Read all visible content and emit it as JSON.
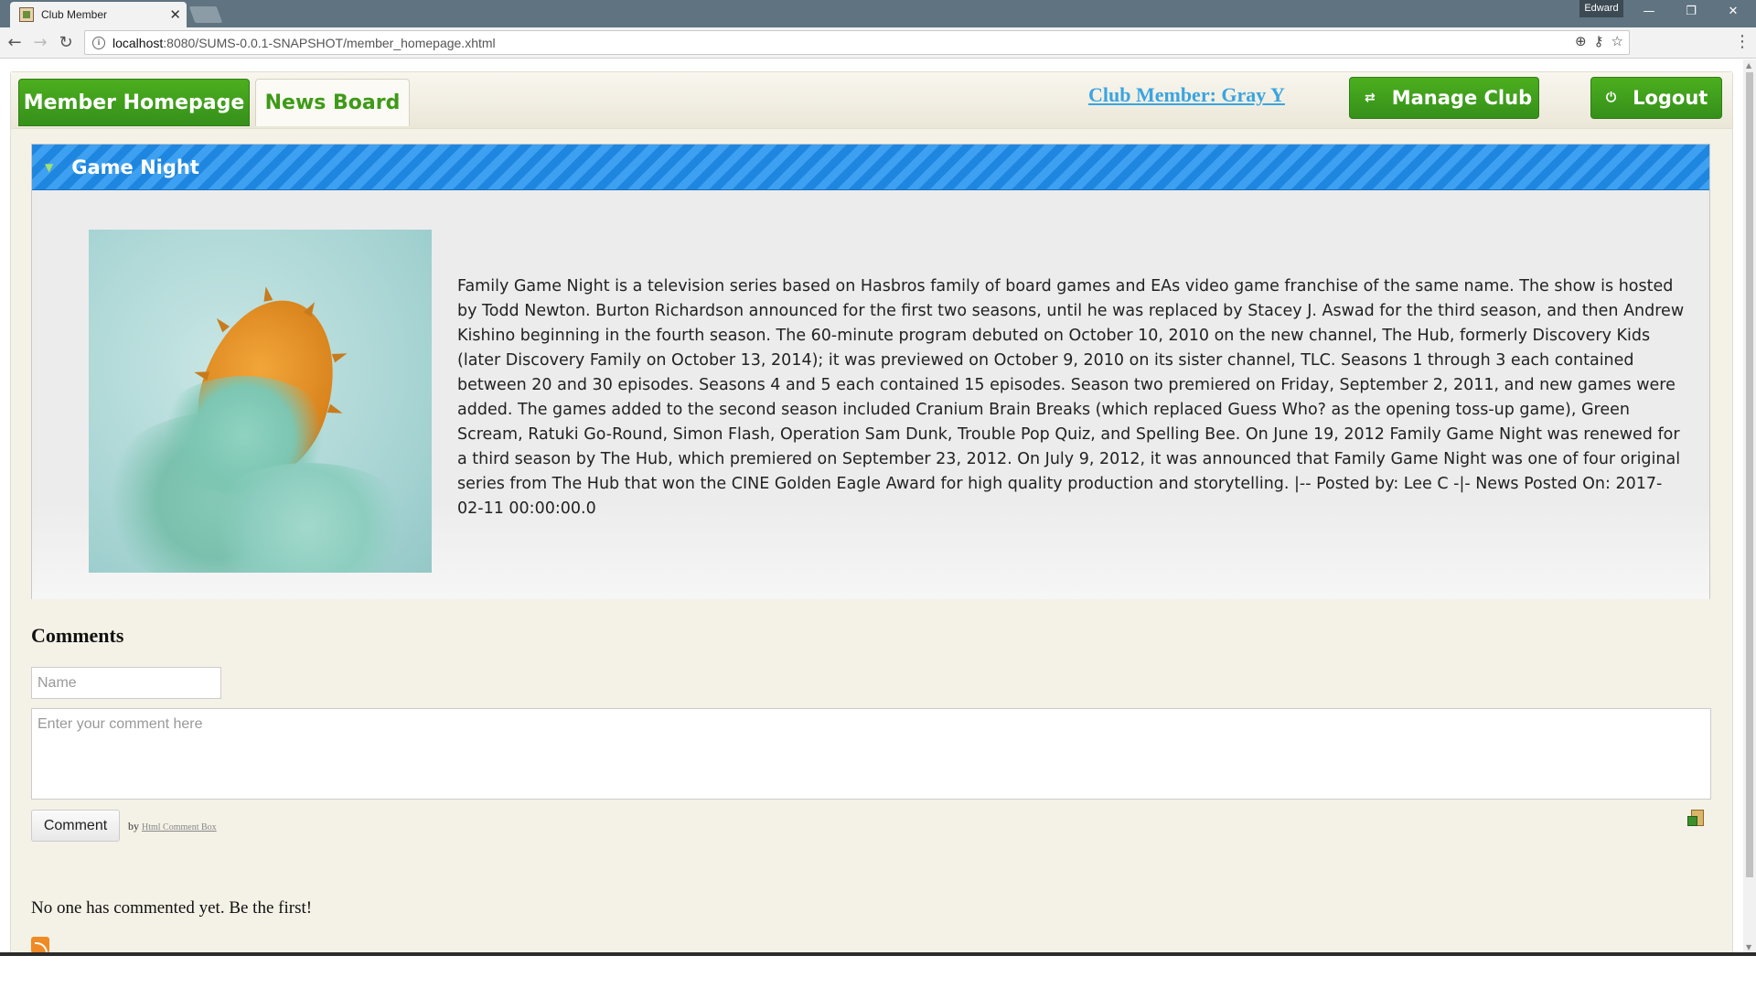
{
  "browser": {
    "tab_title": "Club Member",
    "profile_name": "Edward",
    "url_host": "localhost",
    "url_rest": ":8080/SUMS-0.0.1-SNAPSHOT/member_homepage.xhtml"
  },
  "nav": {
    "tabs": [
      {
        "label": "Member Homepage",
        "active": true
      },
      {
        "label": "News Board",
        "active": false
      }
    ],
    "member_link": "Club Member: Gray Y",
    "manage_button": "Manage Club",
    "logout_button": "Logout"
  },
  "news": {
    "title": "Game Night",
    "body": "Family Game Night is a television series based on Hasbros family of board games and EAs video game franchise of the same name. The show is hosted by Todd Newton. Burton Richardson announced for the first two seasons, until he was replaced by Stacey J. Aswad for the third season, and then Andrew Kishino beginning in the fourth season. The 60-minute program debuted on October 10, 2010 on the new channel, The Hub, formerly Discovery Kids (later Discovery Family on October 13, 2014); it was previewed on October 9, 2010 on its sister channel, TLC. Seasons 1 through 3 each contained between 20 and 30 episodes. Seasons 4 and 5 each contained 15 episodes. Season two premiered on Friday, September 2, 2011, and new games were added. The games added to the second season included Cranium Brain Breaks (which replaced Guess Who? as the opening toss-up game), Green Scream, Ratuki Go-Round, Simon Flash, Operation Sam Dunk, Trouble Pop Quiz, and Spelling Bee. On June 19, 2012 Family Game Night was renewed for a third season by The Hub, which premiered on September 23, 2012. On July 9, 2012, it was announced that Family Game Night was one of four original series from The Hub that won the CINE Golden Eagle Award for high quality production and storytelling. |-- Posted by: Lee C -|- News Posted On: 2017-02-11 00:00:00.0"
  },
  "comments": {
    "title": "Comments",
    "name_placeholder": "Name",
    "comment_placeholder": "Enter your comment here",
    "submit_label": "Comment",
    "by_prefix": "by",
    "by_link": "Html Comment Box",
    "empty_message": "No one has commented yet. Be the first!"
  },
  "colors": {
    "accent_green": "#3e9a17",
    "panel_blue": "#1f86e0",
    "member_link_blue": "#3aa4e0",
    "page_background": "#f4f1e6"
  }
}
